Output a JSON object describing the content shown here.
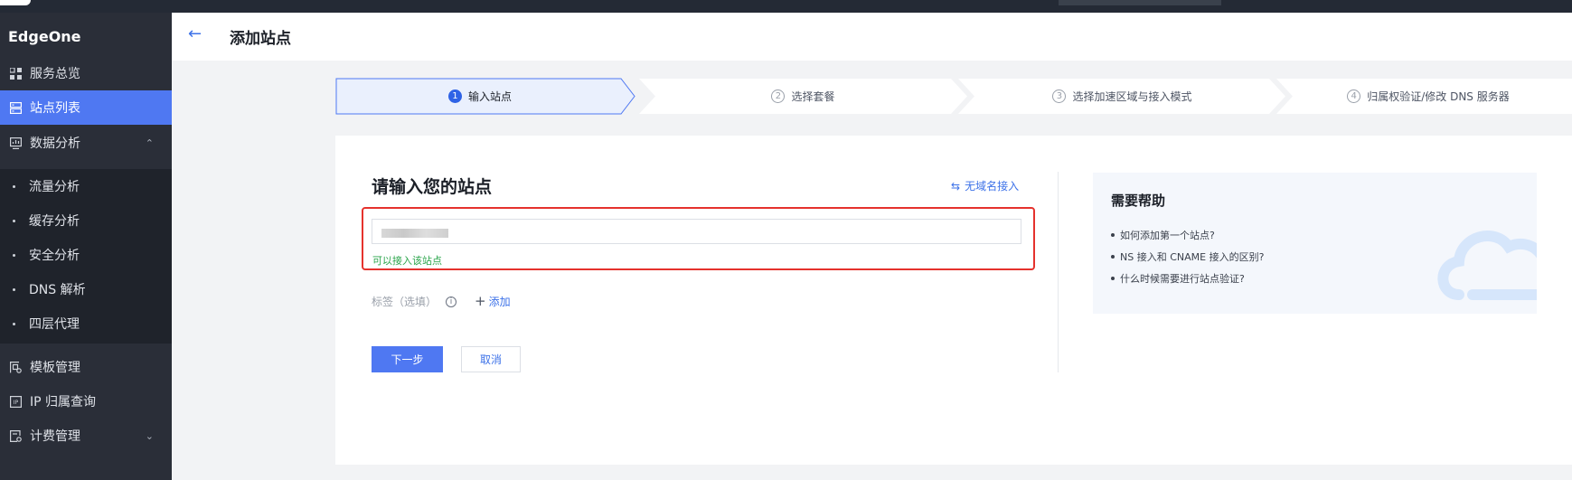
{
  "sidebar": {
    "brand": "EdgeOne",
    "items": [
      {
        "label": "服务总览",
        "icon": "dashboard-icon"
      },
      {
        "label": "站点列表",
        "icon": "site-list-icon",
        "active": true
      },
      {
        "label": "数据分析",
        "icon": "monitor-icon",
        "expanded": true
      },
      {
        "label": "模板管理",
        "icon": "template-icon"
      },
      {
        "label": "IP 归属查询",
        "icon": "ip-icon"
      },
      {
        "label": "计费管理",
        "icon": "billing-icon"
      }
    ],
    "sub_items": [
      "流量分析",
      "缓存分析",
      "安全分析",
      "DNS 解析",
      "四层代理"
    ]
  },
  "header": {
    "title": "添加站点"
  },
  "steps": [
    {
      "num": "1",
      "label": "输入站点",
      "active": true
    },
    {
      "num": "2",
      "label": "选择套餐"
    },
    {
      "num": "3",
      "label": "选择加速区域与接入模式"
    },
    {
      "num": "4",
      "label": "归属权验证/修改 DNS 服务器"
    }
  ],
  "form": {
    "title": "请输入您的站点",
    "no_domain_link": "无域名接入",
    "site_value": "",
    "valid_message": "可以接入该站点",
    "tag_label": "标签（选填）",
    "add_tag": "添加",
    "next_button": "下一步",
    "cancel_button": "取消"
  },
  "help": {
    "title": "需要帮助",
    "items": [
      "如何添加第一个站点?",
      "NS 接入和 CNAME 接入的区别?",
      "什么时候需要进行站点验证?"
    ]
  },
  "colors": {
    "accent": "#4f78f2",
    "sidebar": "#2a2e38",
    "highlight": "#e5322d",
    "success": "#2ba54b"
  }
}
